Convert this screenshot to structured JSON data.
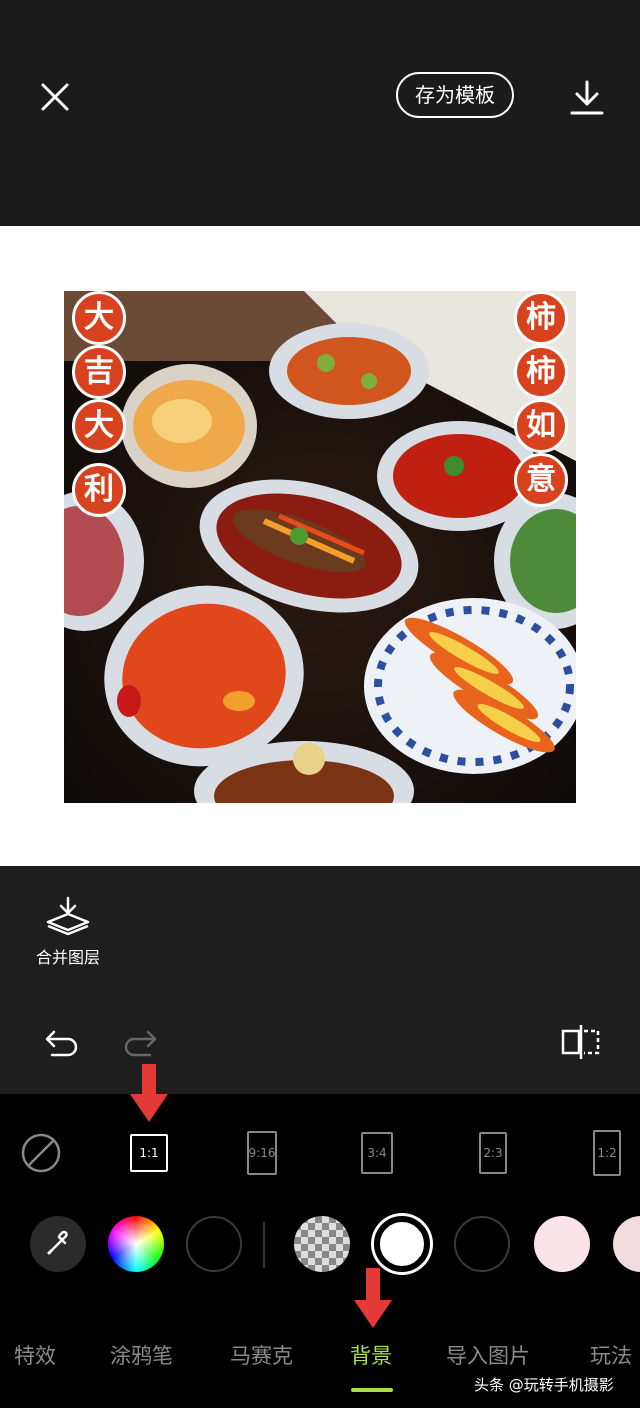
{
  "header": {
    "save_template_label": "存为模板",
    "close_icon": "close-icon",
    "download_icon": "download-icon"
  },
  "canvas": {
    "background_color": "#ffffff",
    "photo": {
      "left_banner": [
        "大",
        "吉",
        "大",
        "利"
      ],
      "right_banner": [
        "柿",
        "柿",
        "如",
        "意"
      ]
    }
  },
  "tools": {
    "merge_layers_label": "合并图层",
    "undo_icon": "undo-icon",
    "redo_icon": "redo-icon",
    "compare_icon": "compare-icon"
  },
  "ratios": [
    {
      "label": "",
      "icon": "none-icon",
      "selected": false
    },
    {
      "label": "1:1",
      "selected": true
    },
    {
      "label": "9:16",
      "selected": false
    },
    {
      "label": "3:4",
      "selected": false
    },
    {
      "label": "2:3",
      "selected": false
    },
    {
      "label": "1:2",
      "selected": false
    }
  ],
  "colors": {
    "accent": "#a8e046",
    "annotation_arrow": "#e53935",
    "swatches": [
      "#000000",
      "#ffffff",
      "#000000",
      "#fbe3ea",
      "#f3dbe0"
    ]
  },
  "tabs": [
    {
      "label": "特效",
      "active": false
    },
    {
      "label": "涂鸦笔",
      "active": false
    },
    {
      "label": "马赛克",
      "active": false
    },
    {
      "label": "背景",
      "active": true
    },
    {
      "label": "导入图片",
      "active": false
    },
    {
      "label": "玩法",
      "active": false
    }
  ],
  "watermark": "头条 @玩转手机摄影"
}
